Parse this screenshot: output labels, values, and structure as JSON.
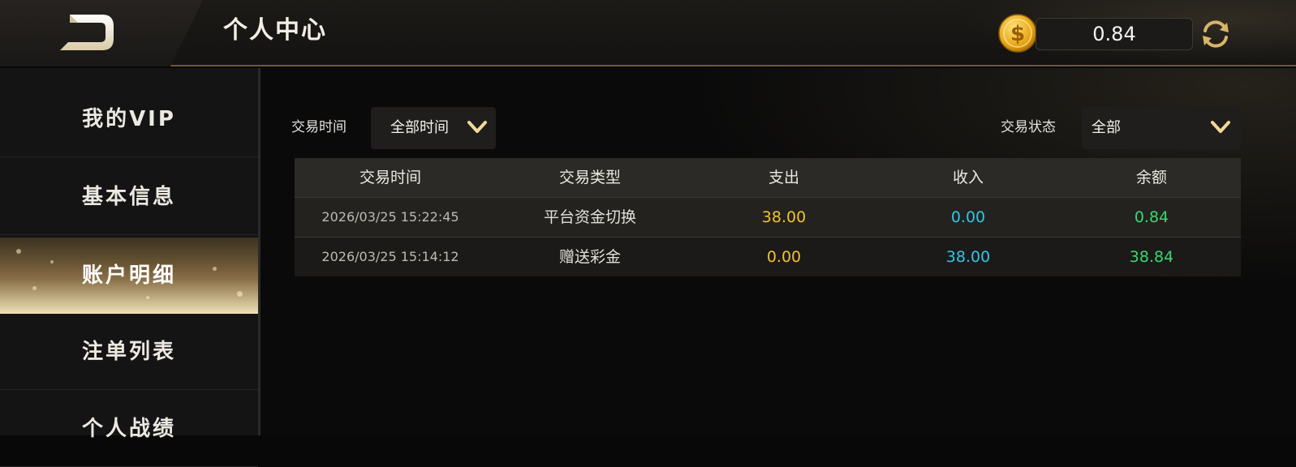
{
  "header": {
    "title": "个人中心",
    "balance": "0.84",
    "icons": {
      "back": "back-arrow-icon",
      "coin": "gold-coin-icon",
      "refresh": "refresh-icon"
    }
  },
  "sidebar": {
    "items": [
      {
        "label": "我的VIP",
        "active": false
      },
      {
        "label": "基本信息",
        "active": false
      },
      {
        "label": "账户明细",
        "active": true
      },
      {
        "label": "注单列表",
        "active": false
      },
      {
        "label": "个人战绩",
        "active": false
      }
    ]
  },
  "filters": {
    "time_label": "交易时间",
    "time_value": "全部时间",
    "status_label": "交易状态",
    "status_value": "全部"
  },
  "table": {
    "columns": [
      "交易时间",
      "交易类型",
      "支出",
      "收入",
      "余额"
    ],
    "rows": [
      {
        "time": "2026/03/25 15:22:45",
        "type": "平台资金切换",
        "out": "38.00",
        "in": "0.00",
        "balance": "0.84"
      },
      {
        "time": "2026/03/25 15:14:12",
        "type": "赠送彩金",
        "out": "0.00",
        "in": "38.00",
        "balance": "38.84"
      }
    ]
  },
  "colors": {
    "gold": "#f0c22f",
    "cyan": "#2fc6e6",
    "green": "#39d66f",
    "accent_border": "#6b5a39"
  }
}
